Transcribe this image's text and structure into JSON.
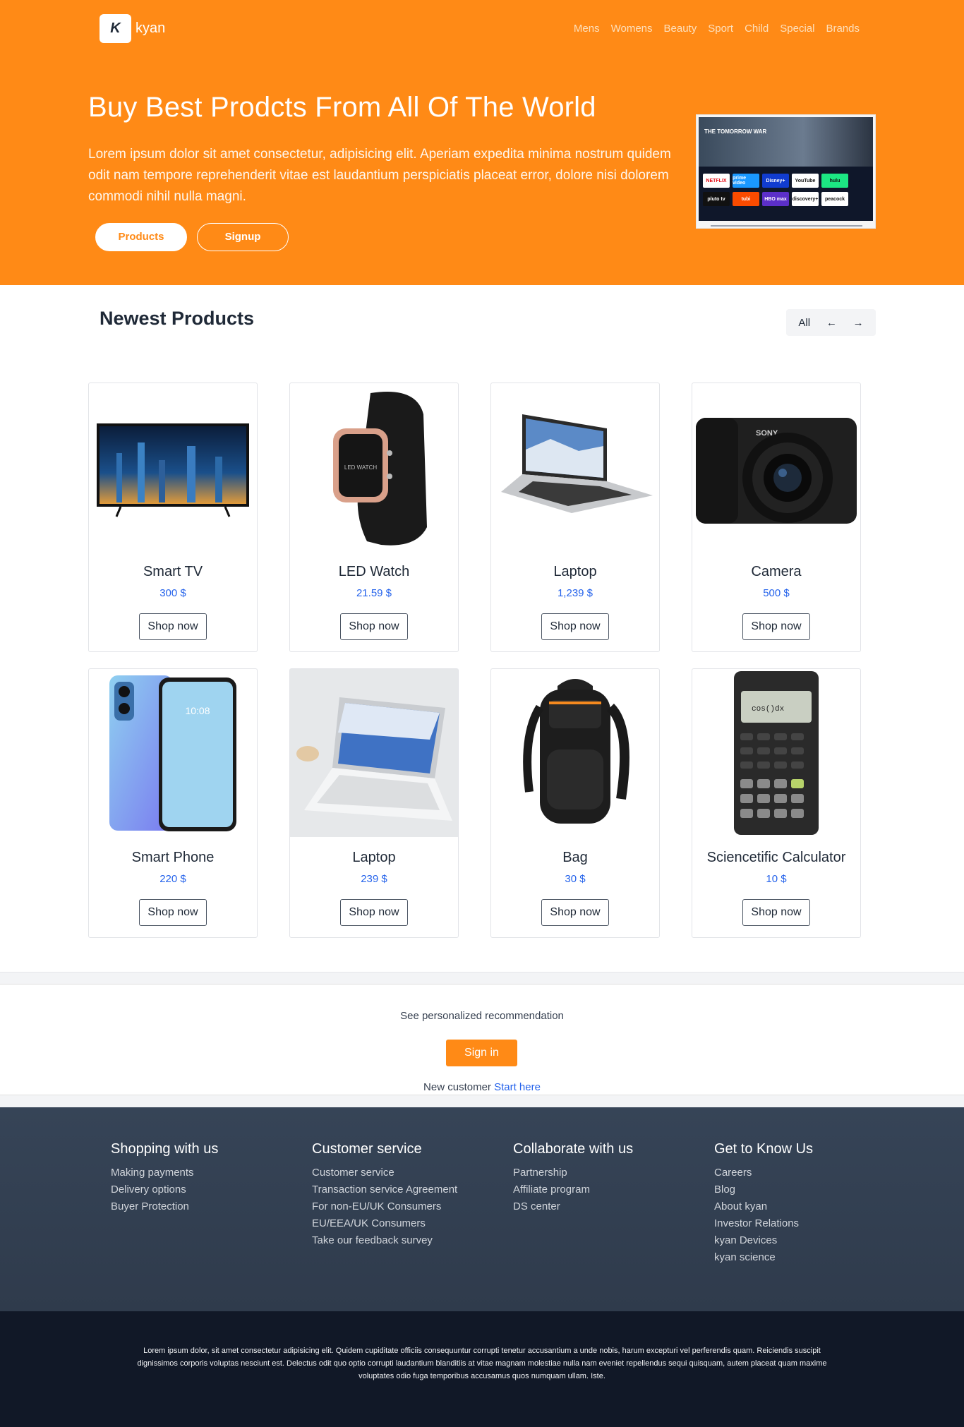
{
  "brand": {
    "logo_letter": "K",
    "name": "kyan"
  },
  "nav": [
    "Mens",
    "Womens",
    "Beauty",
    "Sport",
    "Child",
    "Special",
    "Brands"
  ],
  "hero": {
    "title": "Buy Best Prodcts From All Of The World",
    "text": "Lorem ipsum dolor sit amet consectetur, adipisicing elit. Aperiam expedita minima nostrum quidem odit nam tempore reprehenderit vitae est laudantium perspiciatis placeat error, dolore nisi dolorem commodi nihil nulla magni.",
    "products_button": "Products",
    "signup_button": "Signup",
    "accent_color": "#ff8a16"
  },
  "newest": {
    "title": "Newest Products",
    "filter": "All",
    "prev_icon": "arrow-left-icon",
    "next_icon": "arrow-right-icon"
  },
  "products": [
    {
      "name": "Smart TV",
      "price": "300 $",
      "button": "Shop now"
    },
    {
      "name": "LED Watch",
      "price": "21.59 $",
      "button": "Shop now"
    },
    {
      "name": "Laptop",
      "price": "1,239 $",
      "button": "Shop now"
    },
    {
      "name": "Camera",
      "price": "500 $",
      "button": "Shop now"
    },
    {
      "name": "Smart Phone",
      "price": "220 $",
      "button": "Shop now"
    },
    {
      "name": "Laptop",
      "price": "239 $",
      "button": "Shop now"
    },
    {
      "name": "Bag",
      "price": "30 $",
      "button": "Shop now"
    },
    {
      "name": "Sciencetific Calculator",
      "price": "10 $",
      "button": "Shop now"
    }
  ],
  "recommend": {
    "text": "See personalized recommendation",
    "sign_in": "Sign in",
    "new_customer": "New customer",
    "start_here": "Start here"
  },
  "footer": {
    "columns": [
      {
        "title": "Shopping with us",
        "links": [
          "Making payments",
          "Delivery options",
          "Buyer Protection"
        ]
      },
      {
        "title": "Customer service",
        "links": [
          "Customer service",
          "Transaction service Agreement",
          "For non-EU/UK Consumers",
          "EU/EEA/UK Consumers",
          "Take our feedback survey"
        ]
      },
      {
        "title": "Collaborate with us",
        "links": [
          "Partnership",
          "Affiliate program",
          "DS center"
        ]
      },
      {
        "title": "Get to Know Us",
        "links": [
          "Careers",
          "Blog",
          "About kyan",
          "Investor Relations",
          "kyan Devices",
          "kyan science"
        ]
      }
    ],
    "bottom_text": "Lorem ipsum dolor, sit amet consectetur adipisicing elit. Quidem cupiditate officiis consequuntur corrupti tenetur accusantium a unde nobis, harum excepturi vel perferendis quam. Reiciendis suscipit dignissimos corporis voluptas nesciunt est. Delectus odit quo optio corrupti laudantium blanditiis at vitae magnam molestiae nulla nam eveniet repellendus sequi quisquam, autem placeat quam maxime voluptates odio fuga temporibus accusamus quos numquam ullam. Iste."
  },
  "tv_apps": [
    "NETFLIX",
    "prime video",
    "Disney+",
    "YouTube",
    "hulu",
    "pluto tv",
    "tubi",
    "HBO max",
    "discovery+",
    "peacock"
  ],
  "tv_banner_title": "THE TOMORROW WAR"
}
